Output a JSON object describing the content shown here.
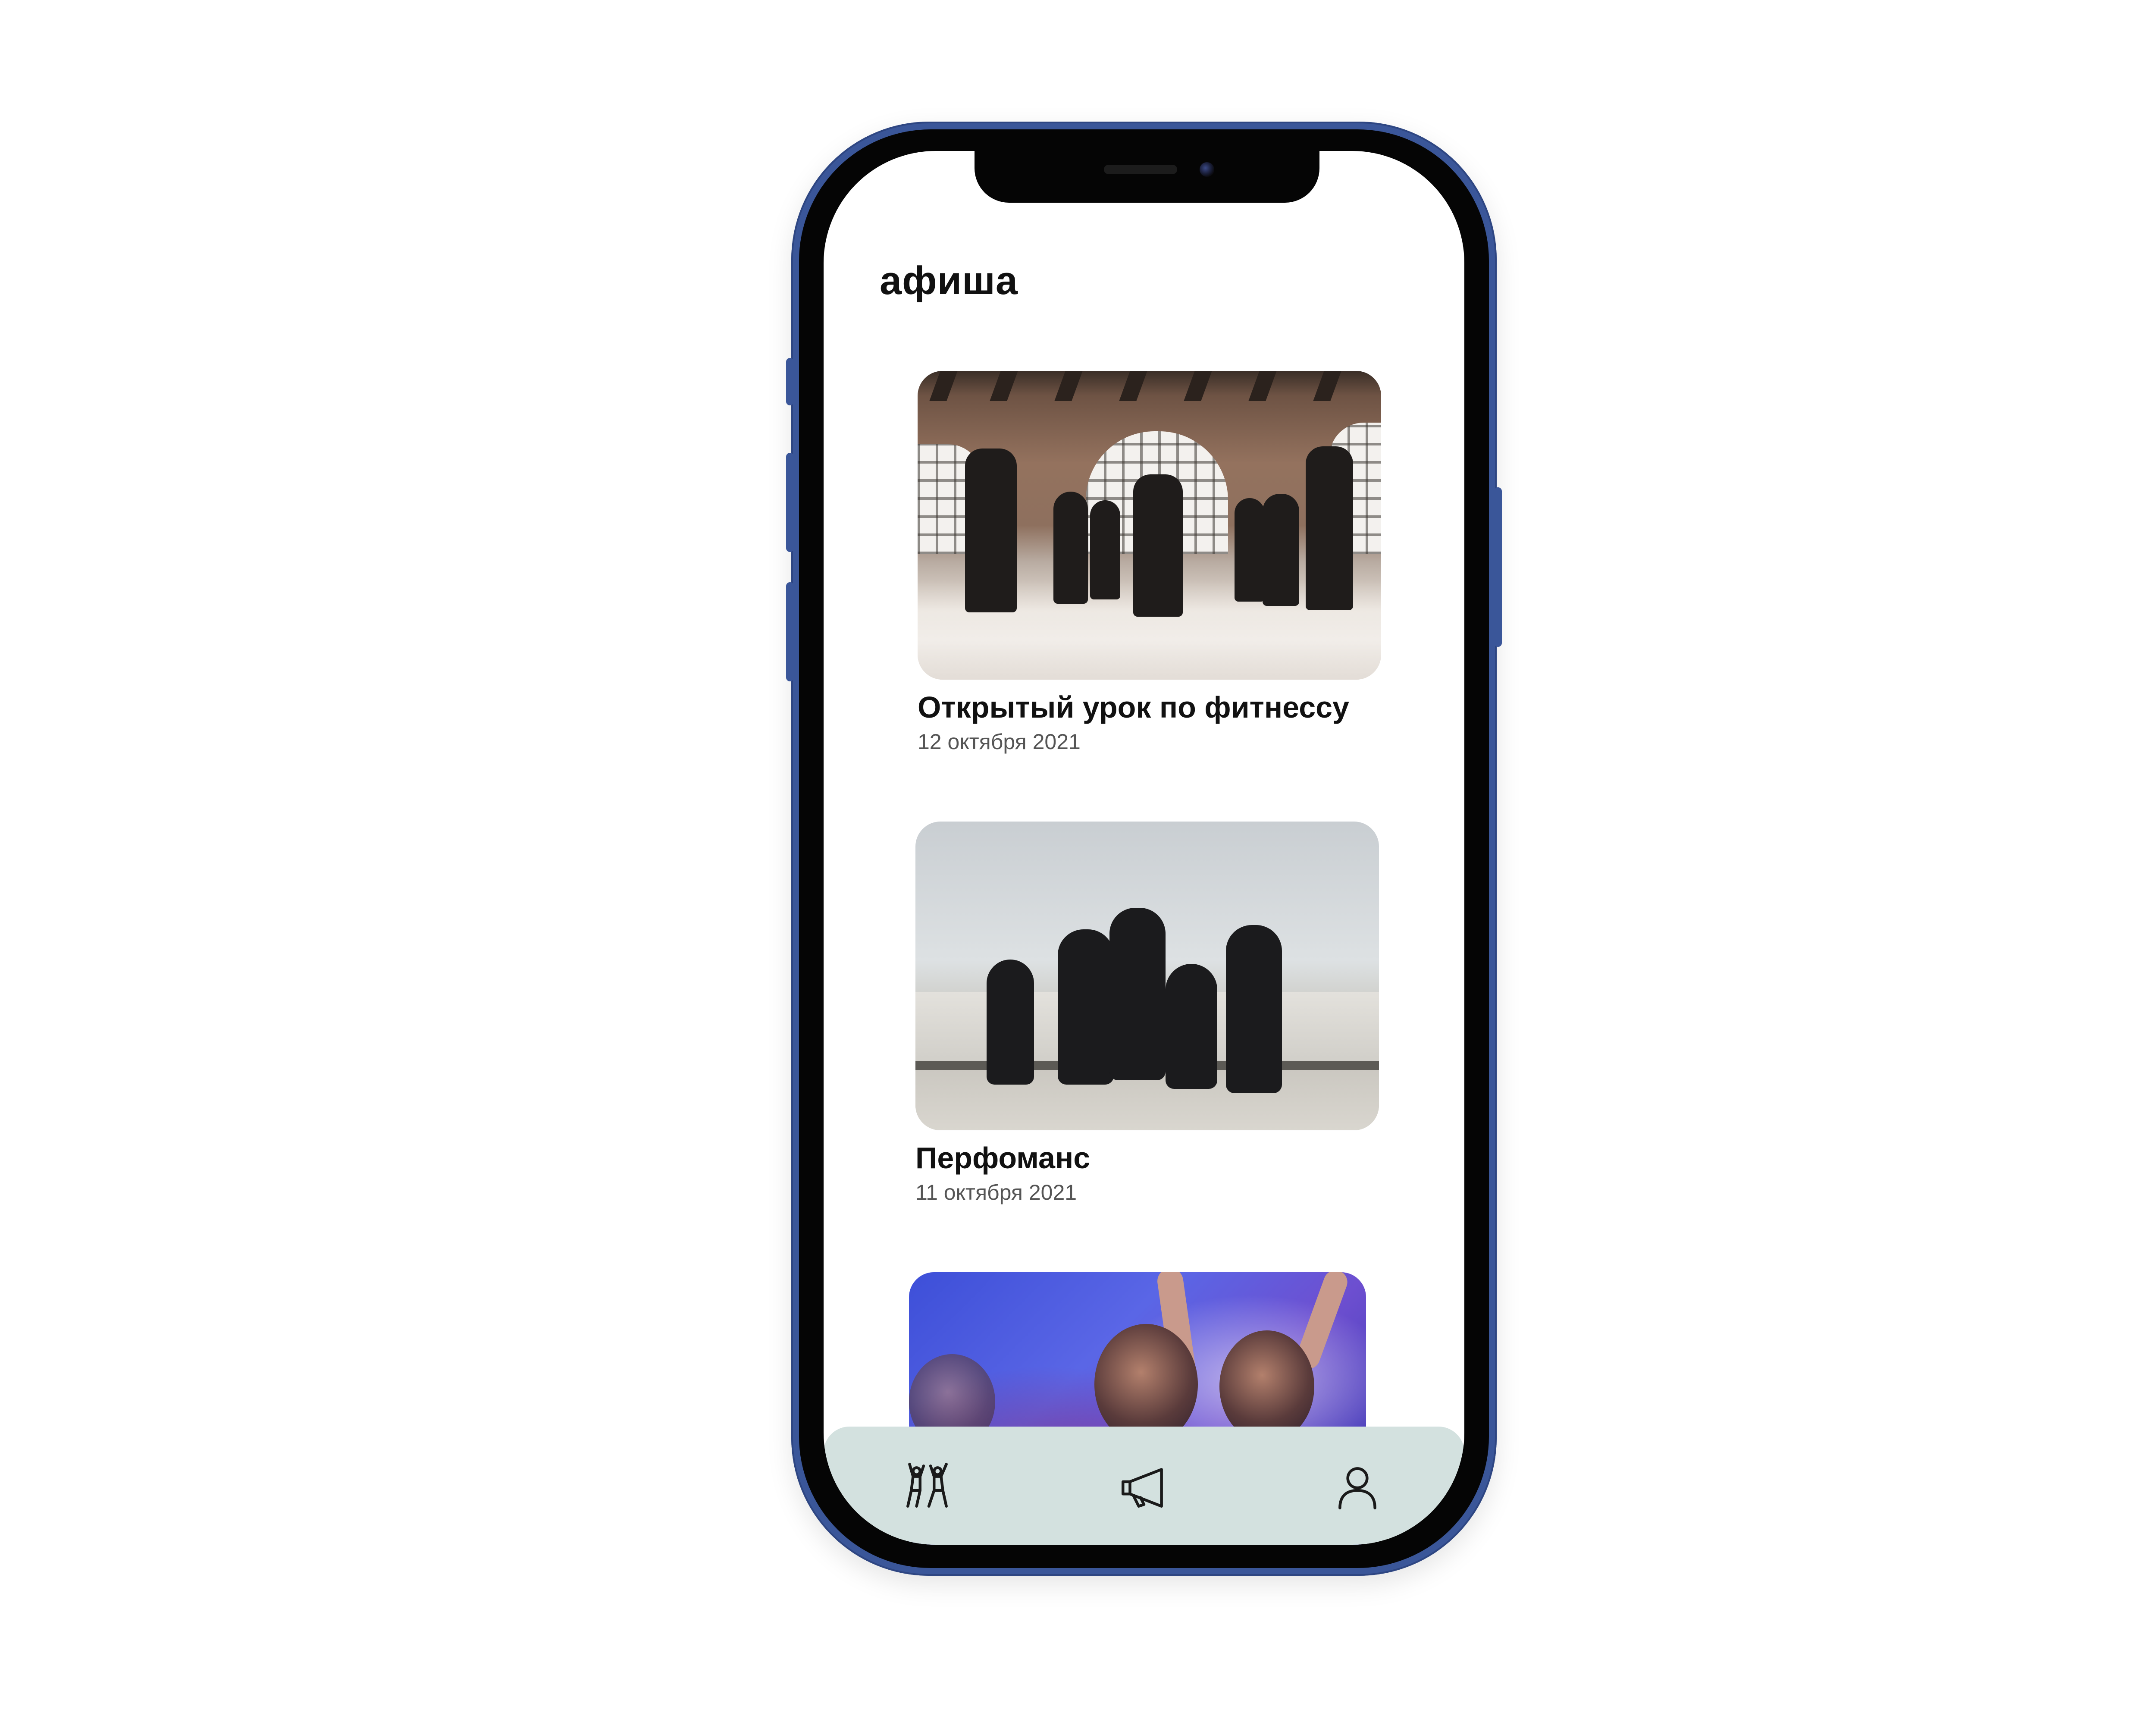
{
  "app": {
    "title": "афиша"
  },
  "events": [
    {
      "title": "Открытый урок по фитнессу",
      "date": "12 октября 2021",
      "image": "fitness-class-photo"
    },
    {
      "title": "Перфоманс",
      "date": "11 октября 2021",
      "image": "dance-performance-photo"
    },
    {
      "title": "",
      "date": "",
      "image": "concert-crowd-photo"
    }
  ],
  "tab_bar": {
    "items": [
      {
        "icon": "dancing-people-icon"
      },
      {
        "icon": "megaphone-icon"
      },
      {
        "icon": "user-profile-icon"
      }
    ],
    "background": "#d3e1df"
  },
  "colors": {
    "phone_frame": "#3a5699",
    "text_primary": "#111111",
    "text_secondary": "#555555"
  }
}
